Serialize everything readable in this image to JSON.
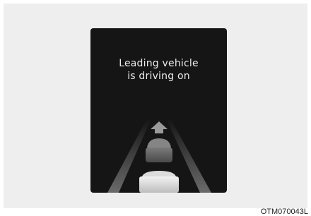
{
  "display": {
    "message_line1": "Leading vehicle",
    "message_line2": "is driving on"
  },
  "icons": {
    "road": "road-lanes-icon",
    "arrow": "up-arrow-icon",
    "lead_vehicle": "leading-vehicle-icon",
    "own_vehicle": "own-vehicle-icon"
  },
  "figure_code": "OTM070043L",
  "colors": {
    "background": "#eeeeee",
    "display": "#151515",
    "text": "#ececec"
  }
}
